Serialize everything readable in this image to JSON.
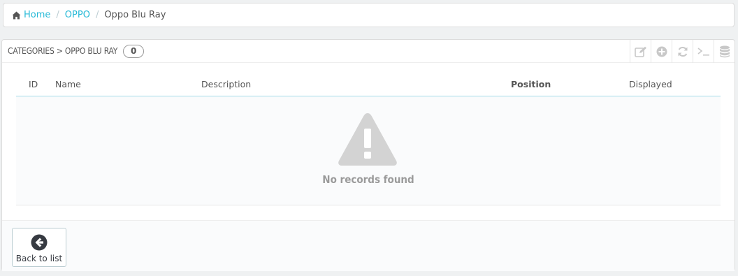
{
  "breadcrumb": {
    "home": "Home",
    "parent": "OPPO",
    "current": "Oppo Blu Ray",
    "separator": "/"
  },
  "panel": {
    "title": "CATEGORIES > OPPO BLU RAY",
    "count": "0",
    "toolbar": [
      {
        "icon": "edit-icon"
      },
      {
        "icon": "add-icon"
      },
      {
        "icon": "refresh-icon"
      },
      {
        "icon": "terminal-icon"
      },
      {
        "icon": "database-icon"
      }
    ]
  },
  "table": {
    "columns": [
      "ID",
      "Name",
      "Description",
      "Position",
      "Displayed"
    ],
    "empty_message": "No records found"
  },
  "footer": {
    "back_label": "Back to list"
  },
  "colors": {
    "link": "#25b9d7",
    "background": "#eff1f2",
    "header_border": "#a4dce8",
    "empty_icon": "#d3d3d3"
  }
}
